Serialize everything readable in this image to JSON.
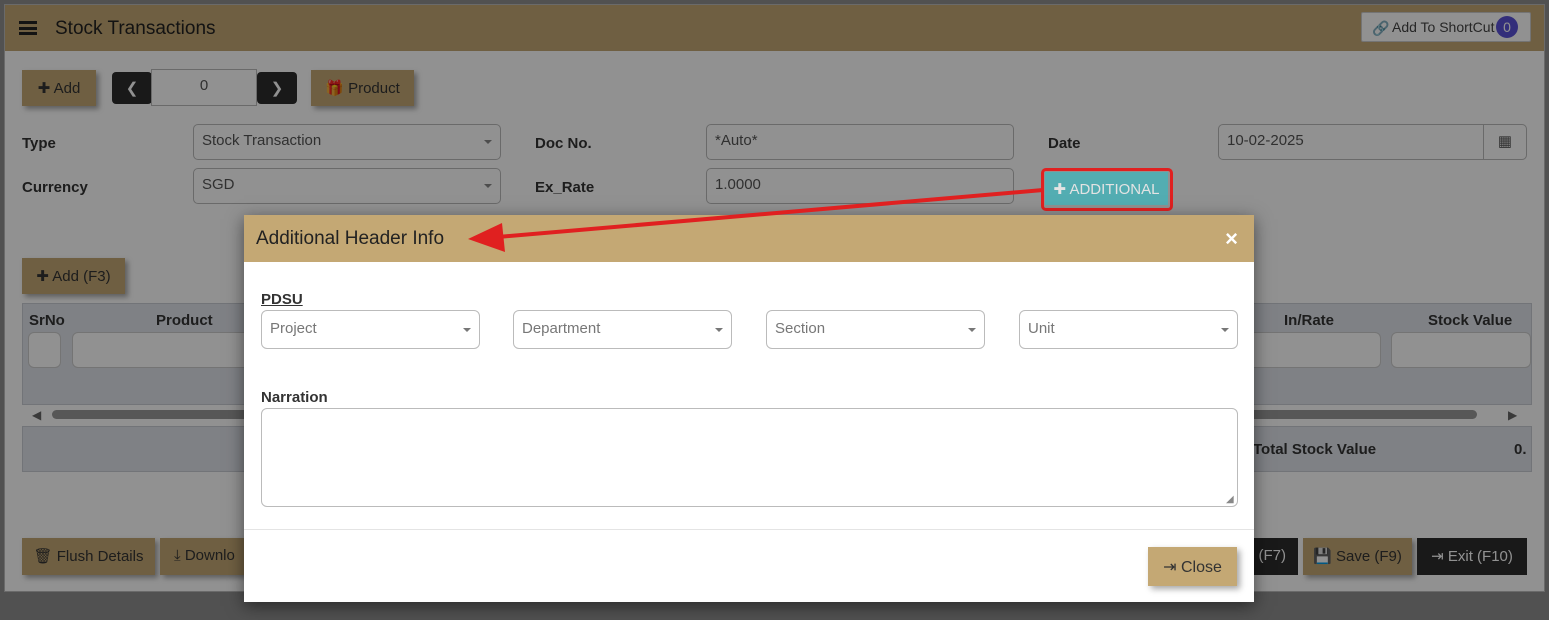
{
  "header": {
    "title": "Stock Transactions",
    "shortcut_label": "Add To ShortCut",
    "shortcut_count": "0"
  },
  "toolbar": {
    "add_label": "Add",
    "record_value": "0",
    "product_label": "Product"
  },
  "form": {
    "type_label": "Type",
    "type_value": "Stock Transaction",
    "docno_label": "Doc No.",
    "docno_value": "*Auto*",
    "date_label": "Date",
    "date_value": "10-02-2025",
    "currency_label": "Currency",
    "currency_value": "SGD",
    "exrate_label": "Ex_Rate",
    "exrate_value": "1.0000",
    "additional_label": "ADDITIONAL"
  },
  "details": {
    "add_label": "Add (F3)",
    "columns": [
      "SrNo",
      "Product",
      "In/Rate",
      "Stock Value"
    ],
    "total_label": "Total Stock Value",
    "total_value": "0."
  },
  "footer": {
    "flush_label": "Flush Details",
    "download_label": "Downlo",
    "f7_label": "(F7)",
    "save_label": "Save (F9)",
    "exit_label": "Exit (F10)"
  },
  "modal": {
    "title": "Additional Header Info",
    "pdsu_label": "PDSU",
    "project_placeholder": "Project",
    "department_placeholder": "Department",
    "section_placeholder": "Section",
    "unit_placeholder": "Unit",
    "narration_label": "Narration",
    "narration_value": "",
    "close_label": "Close"
  },
  "colors": {
    "header_tan": "#c4a874",
    "teal": "#3fb7bd",
    "arrow_red": "#e02020",
    "badge": "#5b52d6"
  },
  "icons": [
    "menu-icon",
    "link-icon",
    "plus-icon",
    "chevron-left-icon",
    "chevron-right-icon",
    "gift-icon",
    "calendar-icon",
    "trash-icon",
    "download-icon",
    "save-icon",
    "exit-icon",
    "close-icon"
  ]
}
